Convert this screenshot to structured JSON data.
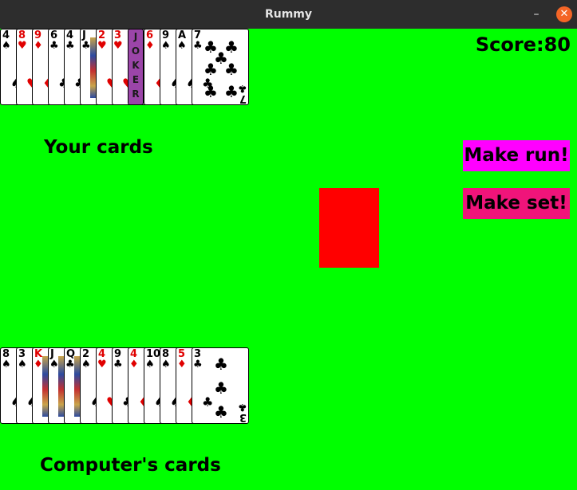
{
  "window": {
    "title": "Rummy",
    "minimize_glyph": "–",
    "close_glyph": "✕"
  },
  "colors": {
    "table": "#00ff00",
    "make_run": "#ff00ff",
    "make_set": "#f0147a",
    "deck_back": "#ff0000",
    "joker": "#9b45a8"
  },
  "score": "Score:80",
  "labels": {
    "your_cards": "Your cards",
    "computer_cards": "Computer's cards"
  },
  "buttons": {
    "make_run": "Make run!",
    "make_set": "Make set!"
  },
  "player_hand": [
    {
      "rank": "4",
      "suit": "♠",
      "color": "black"
    },
    {
      "rank": "8",
      "suit": "♥",
      "color": "red"
    },
    {
      "rank": "9",
      "suit": "♦",
      "color": "red"
    },
    {
      "rank": "6",
      "suit": "♣",
      "color": "black"
    },
    {
      "rank": "4",
      "suit": "♣",
      "color": "black"
    },
    {
      "rank": "J",
      "suit": "♣",
      "color": "black"
    },
    {
      "rank": "2",
      "suit": "♥",
      "color": "red"
    },
    {
      "rank": "3",
      "suit": "♥",
      "color": "red"
    },
    {
      "rank": "JOKER",
      "suit": "",
      "color": "joker"
    },
    {
      "rank": "6",
      "suit": "♦",
      "color": "red"
    },
    {
      "rank": "9",
      "suit": "♠",
      "color": "black"
    },
    {
      "rank": "A",
      "suit": "♠",
      "color": "black"
    },
    {
      "rank": "7",
      "suit": "♣",
      "color": "black"
    }
  ],
  "computer_hand": [
    {
      "rank": "8",
      "suit": "♠",
      "color": "black"
    },
    {
      "rank": "3",
      "suit": "♠",
      "color": "black"
    },
    {
      "rank": "K",
      "suit": "♦",
      "color": "red"
    },
    {
      "rank": "J",
      "suit": "♠",
      "color": "black"
    },
    {
      "rank": "Q",
      "suit": "♣",
      "color": "black"
    },
    {
      "rank": "2",
      "suit": "♠",
      "color": "black"
    },
    {
      "rank": "4",
      "suit": "♥",
      "color": "red"
    },
    {
      "rank": "9",
      "suit": "♣",
      "color": "black"
    },
    {
      "rank": "4",
      "suit": "♦",
      "color": "red"
    },
    {
      "rank": "10",
      "suit": "♠",
      "color": "black"
    },
    {
      "rank": "8",
      "suit": "♠",
      "color": "black"
    },
    {
      "rank": "5",
      "suit": "♦",
      "color": "red"
    },
    {
      "rank": "3",
      "suit": "♣",
      "color": "black"
    }
  ]
}
